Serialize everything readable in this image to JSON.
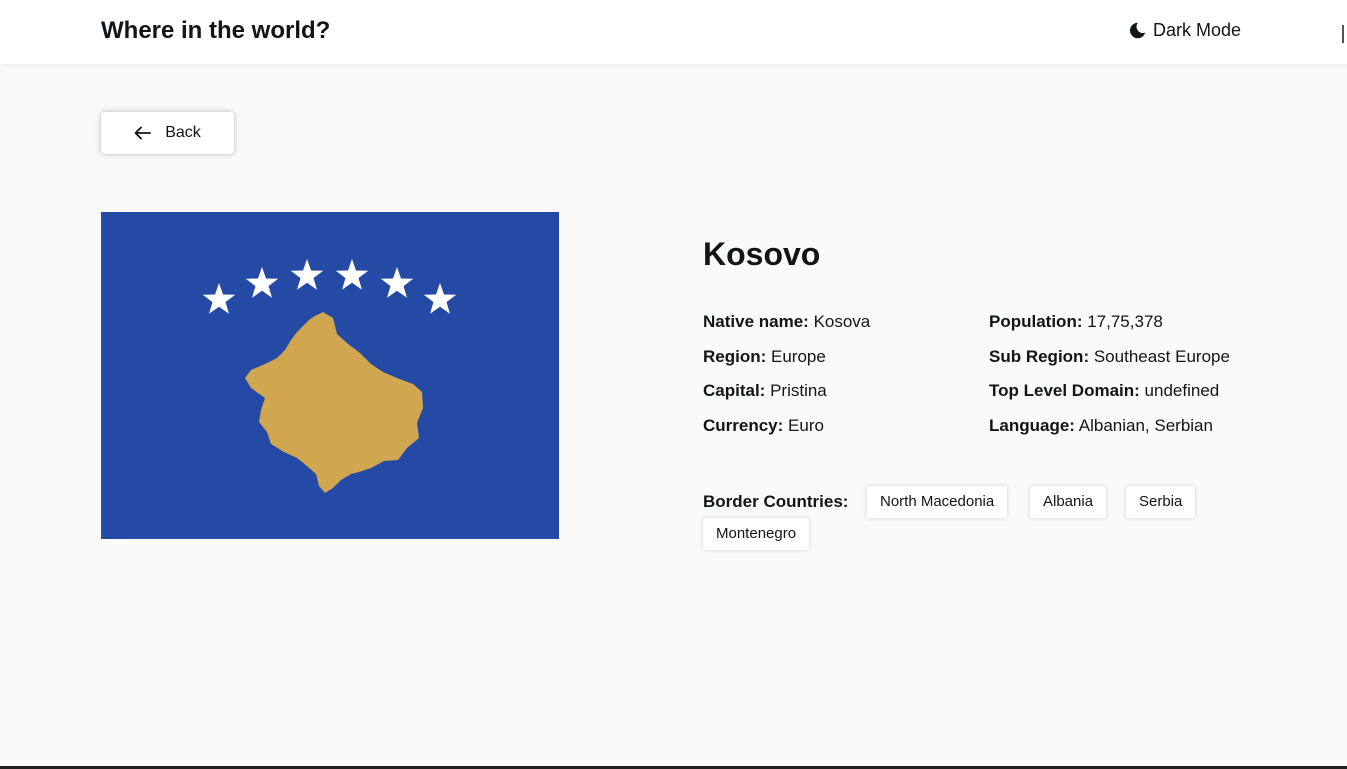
{
  "header": {
    "title": "Where in the world?",
    "theme_toggle_label": "Dark Mode",
    "theme_icon": "moon-icon"
  },
  "back_button": {
    "label": "Back",
    "icon": "arrow-left-icon"
  },
  "flag": {
    "icon": "kosovo-flag",
    "colors": {
      "field": "#244aa5",
      "map": "#d0a650",
      "stars": "#ffffff"
    }
  },
  "country": {
    "name": "Kosovo",
    "details_left": [
      {
        "label": "Native name:",
        "value": "Kosova"
      },
      {
        "label": "Region:",
        "value": "Europe"
      },
      {
        "label": "Capital:",
        "value": "Pristina"
      },
      {
        "label": "Currency:",
        "value": "Euro"
      }
    ],
    "details_right": [
      {
        "label": "Population:",
        "value": "17,75,378"
      },
      {
        "label": "Sub Region:",
        "value": "Southeast Europe"
      },
      {
        "label": "Top Level Domain:",
        "value": "undefined"
      },
      {
        "label": "Language:",
        "value": "Albanian, Serbian"
      }
    ],
    "border_label": "Border Countries:",
    "borders": [
      "North Macedonia",
      "Albania",
      "Serbia",
      "Montenegro"
    ]
  }
}
